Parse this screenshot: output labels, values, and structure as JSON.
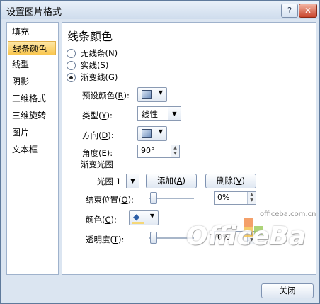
{
  "window": {
    "title": "设置图片格式",
    "help_glyph": "?",
    "close_glyph": "✕"
  },
  "sidebar": {
    "items": [
      {
        "label": "填充"
      },
      {
        "label": "线条颜色",
        "selected": true
      },
      {
        "label": "线型"
      },
      {
        "label": "阴影"
      },
      {
        "label": "三维格式"
      },
      {
        "label": "三维旋转"
      },
      {
        "label": "图片"
      },
      {
        "label": "文本框"
      }
    ]
  },
  "panel": {
    "heading": "线条颜色",
    "radios": [
      {
        "label": "无线条",
        "key": "N",
        "checked": false
      },
      {
        "label": "实线",
        "key": "S",
        "checked": false
      },
      {
        "label": "渐变线",
        "key": "G",
        "checked": true
      }
    ],
    "preset_color": {
      "label": "预设颜色",
      "key": "R"
    },
    "type": {
      "label": "类型",
      "key": "Y",
      "value": "线性"
    },
    "direction": {
      "label": "方向",
      "key": "D"
    },
    "angle": {
      "label": "角度",
      "key": "E",
      "value": "90°"
    },
    "gradient_stops": {
      "section_label": "渐变光圈",
      "stop_select": "光圈 1",
      "add_button": {
        "label": "添加",
        "key": "A"
      },
      "delete_button": {
        "label": "删除",
        "key": "V"
      },
      "end_position": {
        "label": "结束位置",
        "key": "O",
        "value": "0%",
        "slider": 0
      },
      "color": {
        "label": "颜色",
        "key": "C"
      },
      "transparency": {
        "label": "透明度",
        "key": "T",
        "value": "0%",
        "slider": 0
      }
    }
  },
  "footer": {
    "close_button": "关闭"
  },
  "watermark": {
    "url": "officeba.com.cn",
    "brand": "OfficeBa",
    "colors": {
      "square_a": "#f28c4a",
      "square_b": "#9ccb5b",
      "square_c": "#f5c24b"
    }
  },
  "colors": {
    "accent_selection": "#f9c64f",
    "frame": "#dbe5f1"
  }
}
